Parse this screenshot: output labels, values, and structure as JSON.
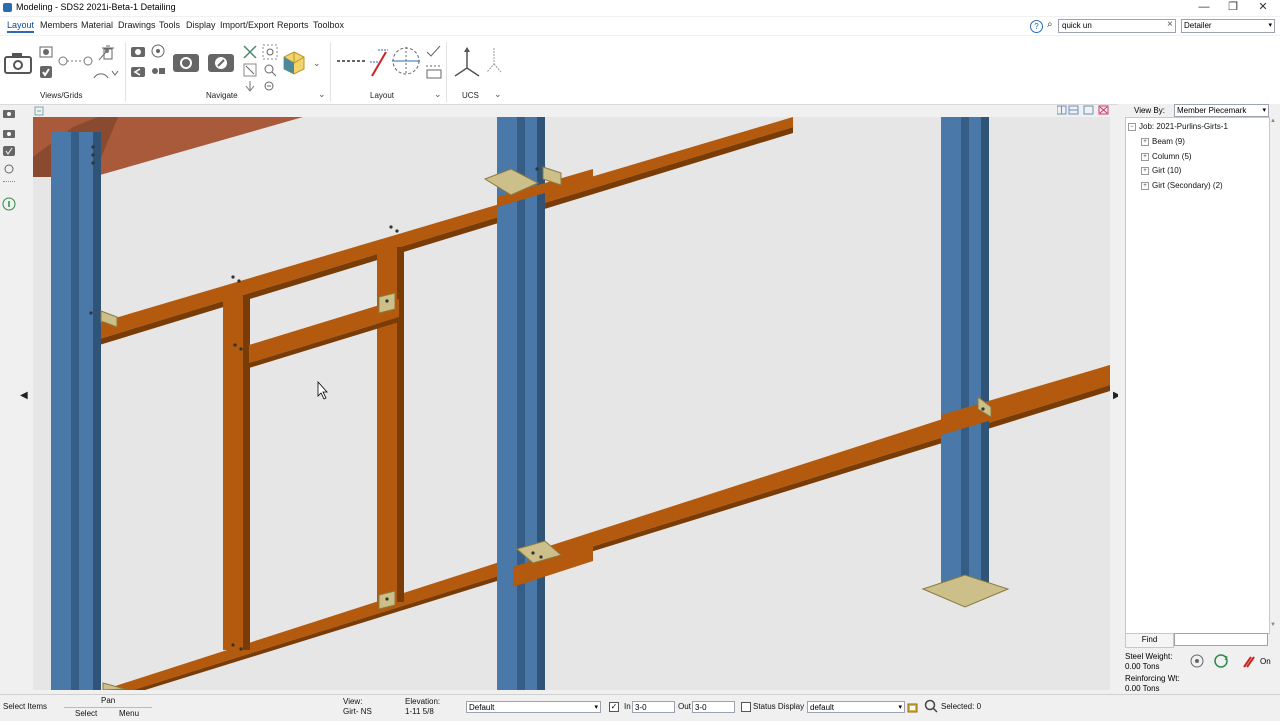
{
  "window": {
    "title": "Modeling - SDS2 2021i-Beta-1 Detailing",
    "minimize": "—",
    "restore": "❐",
    "close": "✕"
  },
  "menu": {
    "items": [
      "Layout",
      "Members",
      "Material",
      "Drawings",
      "Tools",
      "Display",
      "Import/Export",
      "Reports",
      "Toolbox"
    ]
  },
  "search": {
    "value": "quick un",
    "clear": "×"
  },
  "role": {
    "value": "Detailer"
  },
  "ribbon": {
    "groups": {
      "views": "Views/Grids",
      "navigate": "Navigate",
      "layout": "Layout",
      "ucs": "UCS"
    }
  },
  "panel": {
    "view_by_label": "View By:",
    "view_by_value": "Member Piecemark",
    "tree_root": "Job: 2021-Purlins-Girts-1",
    "tree_items": [
      "Beam (9)",
      "Column (5)",
      "Girt (10)",
      "Girt (Secondary) (2)"
    ],
    "find_label": "Find",
    "steel_weight_label": "Steel Weight:",
    "steel_weight_value": "0.00 Tons",
    "reinforcing_label": "Reinforcing Wt:",
    "reinforcing_value": "0.00 Tons",
    "on_label": "On"
  },
  "status": {
    "select_items": "Select Items",
    "pan": "Pan",
    "select": "Select",
    "menu": "Menu",
    "view_label": "View:",
    "view_value": "Girt- NS",
    "elevation_label": "Elevation:",
    "elevation_value": "1-11 5/8",
    "default_select": "Default",
    "in_label": "In",
    "in_value": "3-0",
    "out_label": "Out",
    "out_value": "3-0",
    "status_display": "Status Display",
    "default2": "default",
    "selected": "Selected: 0"
  },
  "colors": {
    "column": "#4a78a8",
    "column_dark": "#355d86",
    "girt": "#b35a0e",
    "girt_dark": "#7a3c06",
    "clip": "#cdbf8a",
    "viewport_bg": "#e6e6e6",
    "accent": "#2b6cb0"
  }
}
